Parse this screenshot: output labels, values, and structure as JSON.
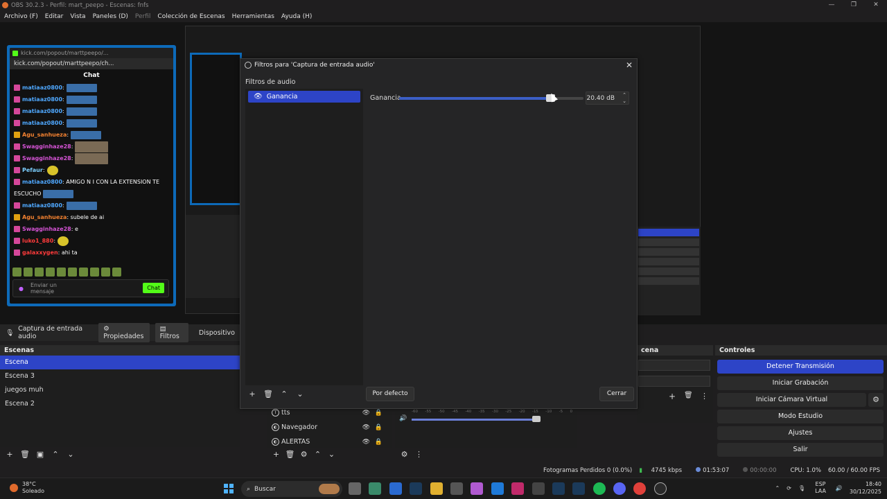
{
  "window": {
    "title": "OBS 30.2.3 - Perfil: mart_peepo - Escenas: fnfs"
  },
  "menu": [
    "Archivo (F)",
    "Editar",
    "Vista",
    "Paneles (D)",
    "Perfil",
    "Colección de Escenas",
    "Herramientas",
    "Ayuda (H)"
  ],
  "chat": {
    "tab_url": "kick.com/popout/marttpeepo/...",
    "url": "kick.com/popout/marttpeepo/ch...",
    "header": "Chat",
    "messages": [
      {
        "user": "matiaaz0800",
        "text": ":",
        "color": "u"
      },
      {
        "user": "matiaaz0800",
        "text": ":",
        "color": "u"
      },
      {
        "user": "matiaaz0800",
        "text": ":",
        "color": "u"
      },
      {
        "user": "matiaaz0800",
        "text": ":",
        "color": "u"
      },
      {
        "user": "Agu_sanhueza",
        "text": ":",
        "color": "o"
      },
      {
        "user": "Swagginhaze28",
        "text": ":",
        "color": "p"
      },
      {
        "user": "Swagginhaze28",
        "text": ":",
        "color": "p"
      },
      {
        "user": "Pefaur",
        "text": ":",
        "color": "g"
      },
      {
        "user": "matiaaz0800",
        "text": ": AMIGO N I CON LA EXTENSION TE",
        "color": "u"
      },
      {
        "user": "ESCUCHO",
        "text": "",
        "color": "w"
      },
      {
        "user": "matiaaz0800",
        "text": ":",
        "color": "u"
      },
      {
        "user": "Agu_sanhueza",
        "text": ": subele de ai",
        "color": "o"
      },
      {
        "user": "Swagginhaze28",
        "text": ": e",
        "color": "p"
      },
      {
        "user": "luko1_880",
        "text": ":",
        "color": "r"
      },
      {
        "user": "galaxxygen",
        "text": ": ahi ta",
        "color": "r"
      }
    ],
    "input_placeholder": "Enviar un mensaje",
    "send_label": "Chat"
  },
  "source_bar": {
    "source_name": "Captura de entrada audio",
    "properties": "Propiedades",
    "filters": "Filtros",
    "device": "Dispositivo"
  },
  "scenes": {
    "title": "Escenas",
    "items": [
      "Escena",
      "Escena 3",
      "juegos muh",
      "Escena 2"
    ],
    "selected": 0
  },
  "sources": {
    "items": [
      {
        "name": "tts",
        "icon": "T"
      },
      {
        "name": "Navegador",
        "icon": "◐"
      },
      {
        "name": "ALERTAS",
        "icon": "◐"
      }
    ]
  },
  "mixer": {
    "ticks": [
      "-60",
      "-55",
      "-50",
      "-45",
      "-40",
      "-35",
      "-30",
      "-25",
      "-20",
      "-15",
      "-10",
      "-5",
      "0"
    ]
  },
  "transitions": {
    "title": "cena"
  },
  "controls": {
    "title": "Controles",
    "buttons": [
      "Detener Transmisión",
      "Iniciar Grabación",
      "Iniciar Cámara Virtual",
      "Modo Estudio",
      "Ajustes",
      "Salir"
    ]
  },
  "status": {
    "dropped": "Fotogramas Perdidos 0 (0.0%)",
    "bitrate": "4745 kbps",
    "live_time": "01:53:07",
    "rec_time": "00:00:00",
    "cpu": "CPU: 1.0%",
    "fps": "60.00 / 60.00 FPS"
  },
  "dialog": {
    "title": "Filtros para 'Captura de entrada audio'",
    "section_label": "Filtros de audio",
    "filter_name": "Ganancia",
    "gain_label": "Ganancia",
    "gain_value": "20.40 dB",
    "slider_fraction": 0.82,
    "defaults_button": "Por defecto",
    "close_button": "Cerrar"
  },
  "taskbar": {
    "temp": "38°C",
    "weather": "Soleado",
    "search": "Buscar",
    "lang1": "ESP",
    "lang2": "LAA",
    "time": "18:40",
    "date": "30/12/2025"
  },
  "colors": {
    "accent": "#2d44c7",
    "kick_green": "#53fc18",
    "chat_border": "#0d6ab9"
  }
}
